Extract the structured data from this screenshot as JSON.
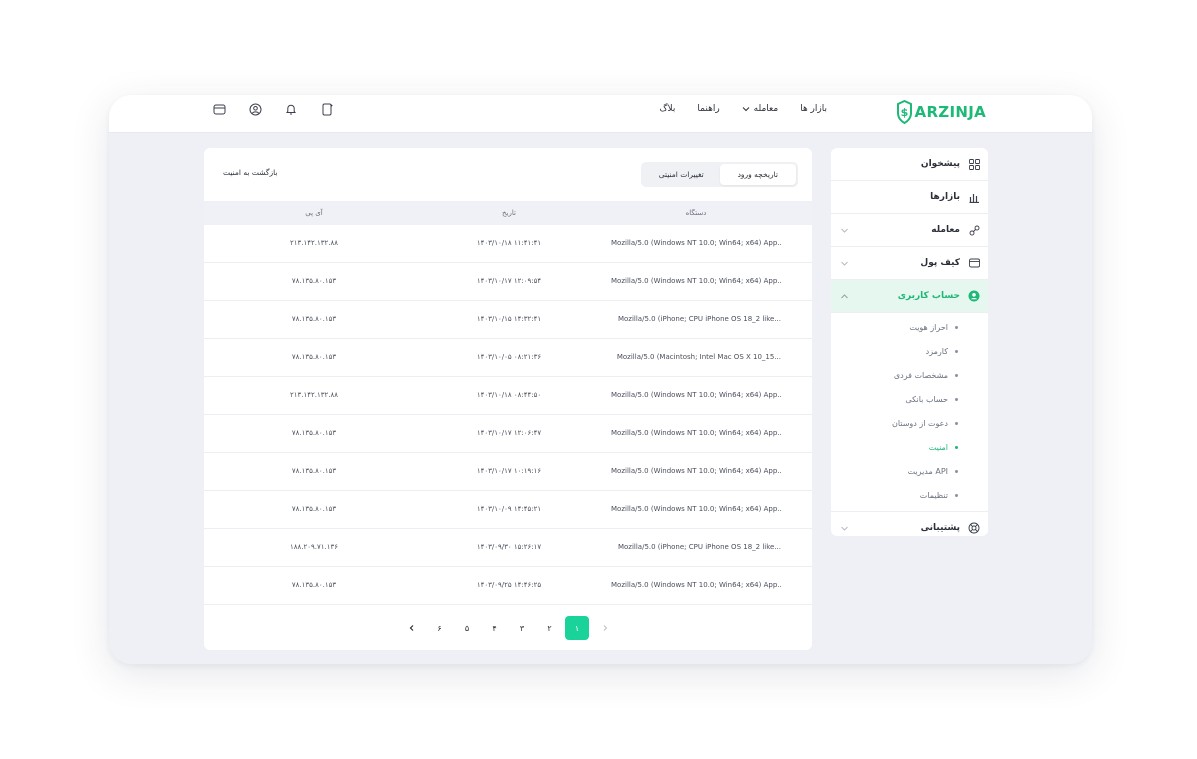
{
  "brand": {
    "name": "ARZINJA",
    "color": "#1eb877"
  },
  "nav": {
    "markets": "بازار ها",
    "trade": "معامله",
    "guide": "راهنما",
    "blog": "بلاگ"
  },
  "top_icons": [
    "wallet-icon",
    "user-circle-icon",
    "bell-icon",
    "phone-plus-icon"
  ],
  "sidebar": {
    "items": [
      {
        "label": "پیشخوان",
        "icon": "dashboard-icon"
      },
      {
        "label": "بازارها",
        "icon": "bar-chart-icon"
      },
      {
        "label": "معامله",
        "icon": "exchange-icon"
      },
      {
        "label": "کیف پول",
        "icon": "wallet-icon"
      },
      {
        "label": "حساب کاربری",
        "icon": "user-icon"
      },
      {
        "label": "پشتیبانی",
        "icon": "support-icon"
      }
    ],
    "account_sub": [
      "احراز هویت",
      "کارمزد",
      "مشخصات فردی",
      "حساب بانکی",
      "دعوت از دوستان",
      "امنیت",
      "مدیریت API",
      "تنظیمات"
    ]
  },
  "panel": {
    "back_label": "بازگشت به امنیت",
    "tabs": [
      "تاریخچه ورود",
      "تغییرات امنیتی"
    ],
    "columns": {
      "device": "دستگاه",
      "date": "تاریخ",
      "ip": "آی پی"
    },
    "rows": [
      {
        "device": "Mozilla/5.0 (Windows NT 10.0; Win64; x64) App...",
        "date": "۱۴۰۳/۱۰/۱۸ ۱۱:۴۱:۴۱",
        "ip": "۲۱۳.۱۴۲.۱۳۲.۸۸"
      },
      {
        "device": "Mozilla/5.0 (Windows NT 10.0; Win64; x64) App...",
        "date": "۱۴۰۳/۱۰/۱۷ ۱۲:۰۹:۵۴",
        "ip": "۷۸.۱۳۵.۸۰.۱۵۳"
      },
      {
        "device": "Mozilla/5.0 (iPhone; CPU iPhone OS 18_2 like...",
        "date": "۱۴۰۳/۱۰/۱۵ ۱۴:۳۲:۴۱",
        "ip": "۷۸.۱۳۵.۸۰.۱۵۳"
      },
      {
        "device": "Mozilla/5.0 (Macintosh; Intel Mac OS X 10_15...",
        "date": "۱۴۰۳/۱۰/۰۵ ۰۸:۲۱:۳۶",
        "ip": "۷۸.۱۳۵.۸۰.۱۵۳"
      },
      {
        "device": "Mozilla/5.0 (Windows NT 10.0; Win64; x64) App...",
        "date": "۱۴۰۳/۱۰/۱۸ ۰۸:۴۴:۵۰",
        "ip": "۲۱۳.۱۴۲.۱۳۲.۸۸"
      },
      {
        "device": "Mozilla/5.0 (Windows NT 10.0; Win64; x64) App...",
        "date": "۱۴۰۳/۱۰/۱۷ ۱۲:۰۶:۴۷",
        "ip": "۷۸.۱۳۵.۸۰.۱۵۳"
      },
      {
        "device": "Mozilla/5.0 (Windows NT 10.0; Win64; x64) App...",
        "date": "۱۴۰۳/۱۰/۱۷ ۱۰:۱۹:۱۶",
        "ip": "۷۸.۱۳۵.۸۰.۱۵۳"
      },
      {
        "device": "Mozilla/5.0 (Windows NT 10.0; Win64; x64) App...",
        "date": "۱۴۰۳/۱۰/۰۹ ۱۴:۴۵:۲۱",
        "ip": "۷۸.۱۳۵.۸۰.۱۵۳"
      },
      {
        "device": "Mozilla/5.0 (iPhone; CPU iPhone OS 18_2 like...",
        "date": "۱۴۰۳/۰۹/۳۰ ۱۵:۲۶:۱۷",
        "ip": "۱۸۸.۲۰۹.۷۱.۱۳۶"
      },
      {
        "device": "Mozilla/5.0 (Windows NT 10.0; Win64; x64) App...",
        "date": "۱۴۰۳/۰۹/۲۵ ۱۴:۴۶:۲۵",
        "ip": "۷۸.۱۳۵.۸۰.۱۵۳"
      }
    ],
    "pagination": {
      "pages": [
        "۱",
        "۲",
        "۳",
        "۴",
        "۵",
        "۶"
      ],
      "current": "۱"
    }
  }
}
